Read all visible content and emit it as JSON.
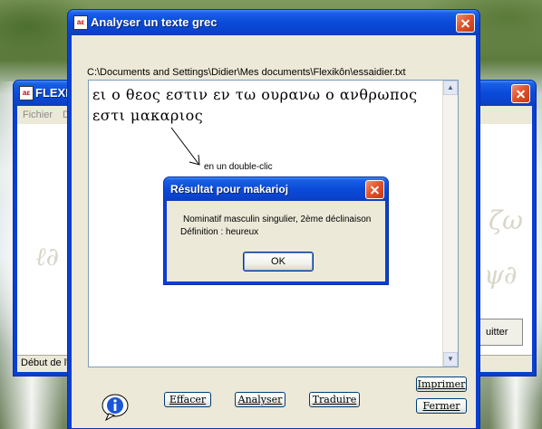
{
  "windows": {
    "back": {
      "title": "FLEXI",
      "menu": [
        "Fichier",
        "D"
      ],
      "status": "Début de l'",
      "partial_button": "uitter"
    },
    "main": {
      "title": "Analyser un texte grec",
      "file_path": "C:\\Documents and Settings\\Didier\\Mes documents\\Flexikôn\\essaidier.txt",
      "greek_text": "ει ο θεος εστιν εν τω ουρανω ο ανθρωπος εστι μακαριος",
      "annotation": "en un double-clic",
      "buttons": {
        "effacer": "Effacer",
        "analyser": "Analyser",
        "traduire": "Traduire",
        "imprimer": "Imprimer",
        "fermer": "Fermer"
      }
    },
    "result": {
      "title": "Résultat pour makarioj",
      "line1": "Nominatif masculin singulier, 2ème déclinaison",
      "line2": "Définition : heureux",
      "ok": "OK"
    }
  },
  "icons": {
    "app": "app-icon",
    "info": "info-icon",
    "close": "close-icon",
    "arrow": "arrow-annotation-icon"
  },
  "colors": {
    "titlebar": "#0a4ad9",
    "close_button": "#e1542c",
    "dialog_face": "#ece9d8",
    "text_border": "#7f9db9"
  }
}
